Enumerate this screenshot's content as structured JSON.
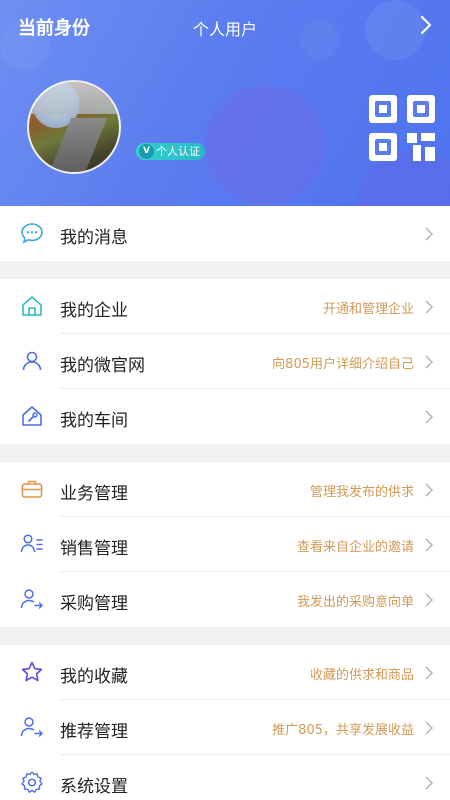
{
  "header": {
    "identity_label": "当前身份",
    "user_type": "个人用户",
    "cert_badge_letter": "V",
    "cert_badge_label": "个人认证"
  },
  "menu": {
    "group1": [
      {
        "label": "我的消息",
        "hint": "",
        "icon": "message-icon"
      }
    ],
    "group2": [
      {
        "label": "我的企业",
        "hint": "开通和管理企业",
        "icon": "company-icon"
      },
      {
        "label": "我的微官网",
        "hint": "向805用户详细介绍自己",
        "icon": "person-icon"
      },
      {
        "label": "我的车间",
        "hint": "",
        "icon": "workshop-icon"
      }
    ],
    "group3": [
      {
        "label": "业务管理",
        "hint": "管理我发布的供求",
        "icon": "briefcase-icon"
      },
      {
        "label": "销售管理",
        "hint": "查看来自企业的邀请",
        "icon": "sales-list-icon"
      },
      {
        "label": "采购管理",
        "hint": "我发出的采购意向单",
        "icon": "purchase-person-icon"
      }
    ],
    "group4": [
      {
        "label": "我的收藏",
        "hint": "收藏的供求和商品",
        "icon": "star-icon"
      },
      {
        "label": "推荐管理",
        "hint": "推广805，共享发展收益",
        "icon": "recommend-person-icon"
      },
      {
        "label": "系统设置",
        "hint": "",
        "icon": "gear-icon"
      }
    ]
  },
  "colors": {
    "header_start": "#6f8ff2",
    "header_end": "#4f73ef",
    "hint_text": "#d39a57",
    "badge": "#2fc4c9"
  }
}
